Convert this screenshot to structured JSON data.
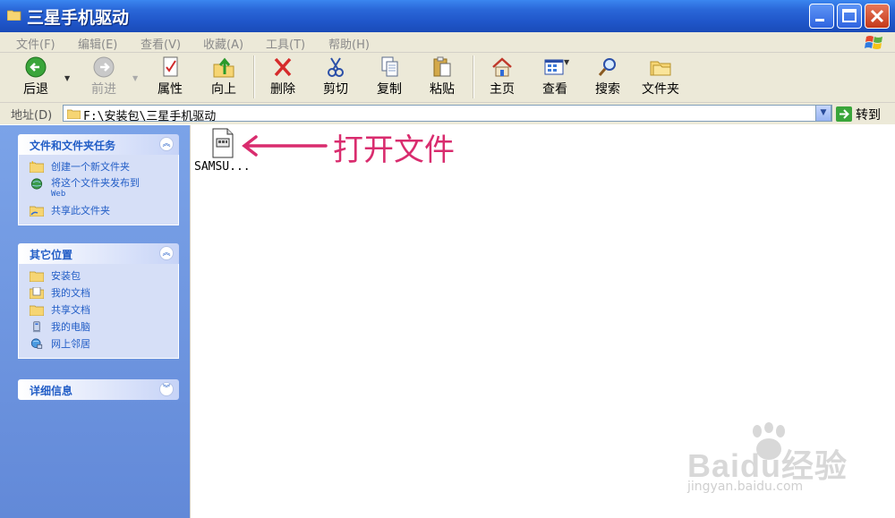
{
  "window": {
    "title": "三星手机驱动"
  },
  "menu": [
    "文件(F)",
    "编辑(E)",
    "查看(V)",
    "收藏(A)",
    "工具(T)",
    "帮助(H)"
  ],
  "toolbar": {
    "back": "后退",
    "forward": "前进",
    "properties": "属性",
    "up": "向上",
    "delete": "删除",
    "cut": "剪切",
    "copy": "复制",
    "paste": "粘贴",
    "home": "主页",
    "views": "查看",
    "search": "搜索",
    "folders": "文件夹"
  },
  "address": {
    "label": "地址(D)",
    "path": "F:\\安装包\\三星手机驱动",
    "go": "转到"
  },
  "tasks_panel": {
    "title": "文件和文件夹任务",
    "items": [
      "创建一个新文件夹",
      "将这个文件夹发布到",
      "共享此文件夹"
    ],
    "publish_sub": "Web"
  },
  "places_panel": {
    "title": "其它位置",
    "items": [
      "安装包",
      "我的文档",
      "共享文档",
      "我的电脑",
      "网上邻居"
    ]
  },
  "details_panel": {
    "title": "详细信息"
  },
  "file": {
    "name": "SAMSU..."
  },
  "annotation": {
    "text": "打开文件",
    "color": "#d92c6e"
  },
  "watermark": {
    "main": "Baidu经验",
    "sub": "jingyan.baidu.com"
  }
}
